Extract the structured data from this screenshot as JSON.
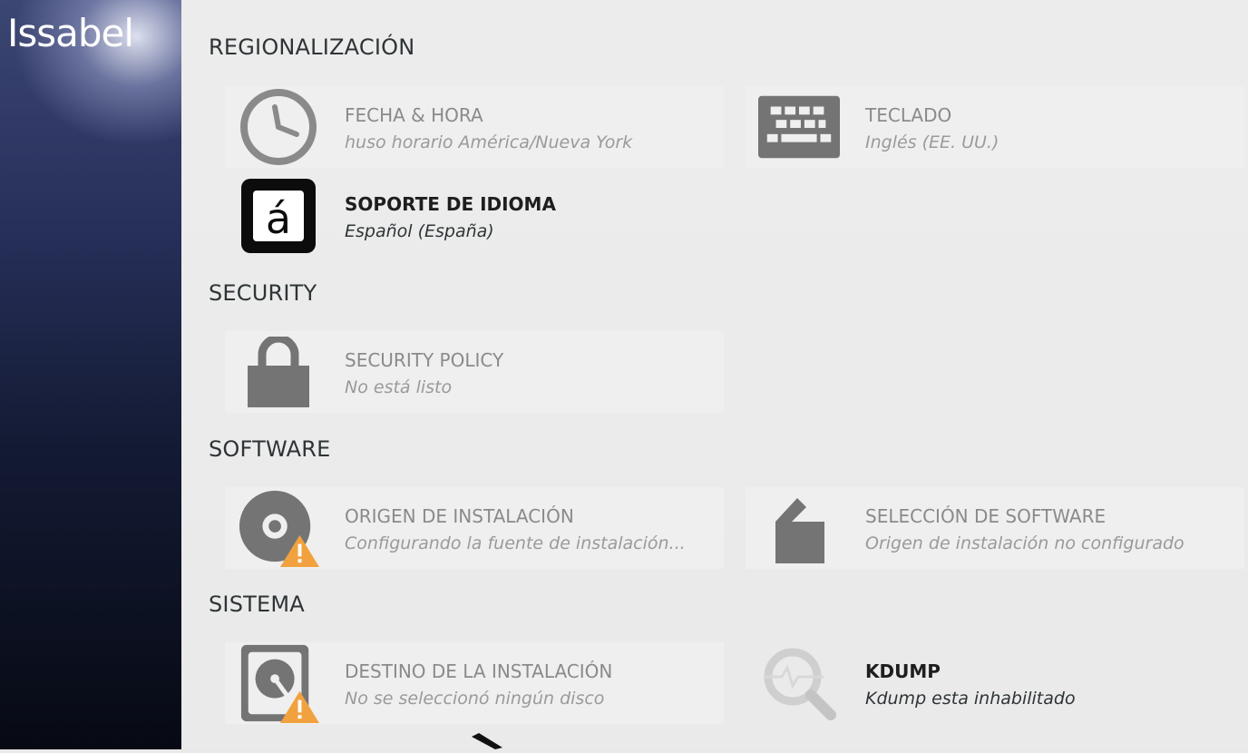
{
  "sidebar": {
    "logo_text": "Issabel"
  },
  "sections": {
    "regional": {
      "title": "REGIONALIZACIÓN",
      "datetime": {
        "title": "FECHA & HORA",
        "status": "huso horario América/Nueva York",
        "icon": "clock-icon"
      },
      "keyboard": {
        "title": "TECLADO",
        "status": "Inglés (EE. UU.)",
        "icon": "keyboard-icon"
      },
      "language": {
        "title": "SOPORTE DE IDIOMA",
        "status": "Español (España)",
        "icon": "language-icon",
        "glyph": "á"
      }
    },
    "security": {
      "title": "SECURITY",
      "policy": {
        "title": "SECURITY POLICY",
        "status": "No está listo",
        "icon": "lock-icon"
      }
    },
    "software": {
      "title": "SOFTWARE",
      "source": {
        "title": "ORIGEN DE INSTALACIÓN",
        "status": "Configurando la fuente de instalación...",
        "icon": "disc-warning-icon"
      },
      "selection": {
        "title": "SELECCIÓN DE SOFTWARE",
        "status": "Origen de instalación no configurado",
        "icon": "package-icon"
      }
    },
    "system": {
      "title": "SISTEMA",
      "destination": {
        "title": "DESTINO DE LA INSTALACIÓN",
        "status": "No se seleccionó ningún disco",
        "icon": "harddisk-warning-icon"
      },
      "kdump": {
        "title": "KDUMP",
        "status": "Kdump esta inhabilitado",
        "icon": "kdump-icon"
      }
    }
  },
  "colors": {
    "warning": "#f1a23e",
    "icon_gray": "#747474",
    "text_dark": "#1e1e1e",
    "text_muted": "#8a8a8a"
  }
}
